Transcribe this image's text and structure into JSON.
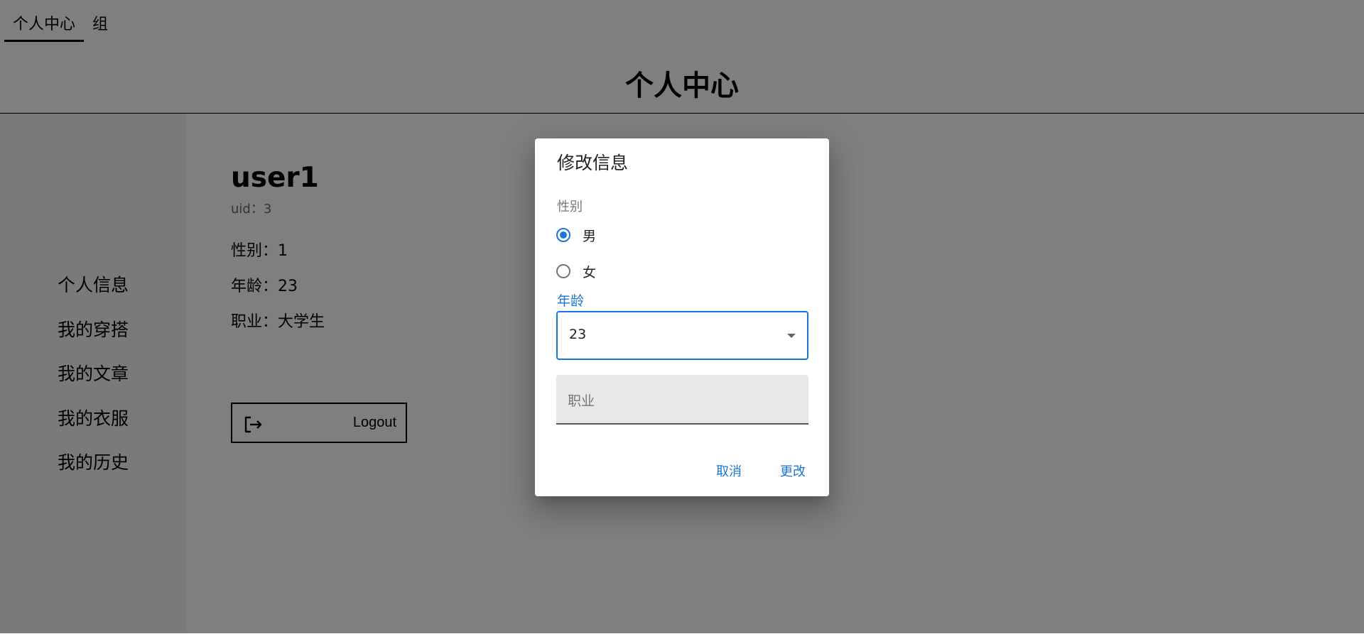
{
  "top_tabs": [
    {
      "label": "个人中心",
      "active": true
    },
    {
      "label": "组",
      "active": false
    }
  ],
  "page_title": "个人中心",
  "sidebar": {
    "items": [
      {
        "label": "个人信息",
        "active": true
      },
      {
        "label": "我的穿搭",
        "active": false
      },
      {
        "label": "我的文章",
        "active": false
      },
      {
        "label": "我的衣服",
        "active": false
      },
      {
        "label": "我的历史",
        "active": false
      }
    ]
  },
  "profile": {
    "username": "user1",
    "uid_text": "uid：3",
    "gender_text": "性别：1",
    "age_text": "年龄：23",
    "job_text": "职业：大学生",
    "logout_label": "Logout",
    "logout_icon": "logout-icon"
  },
  "dialog": {
    "title": "修改信息",
    "gender_label": "性别",
    "gender_options": [
      {
        "label": "男",
        "checked": true
      },
      {
        "label": "女",
        "checked": false
      }
    ],
    "age_label": "年龄",
    "age_value": "23",
    "job_placeholder": "职业",
    "cancel_label": "取消",
    "confirm_label": "更改"
  },
  "colors": {
    "accent": "#1976d2",
    "overlay": "rgba(0,0,0,0.5)",
    "sidebar_active_bg": "#000000"
  }
}
